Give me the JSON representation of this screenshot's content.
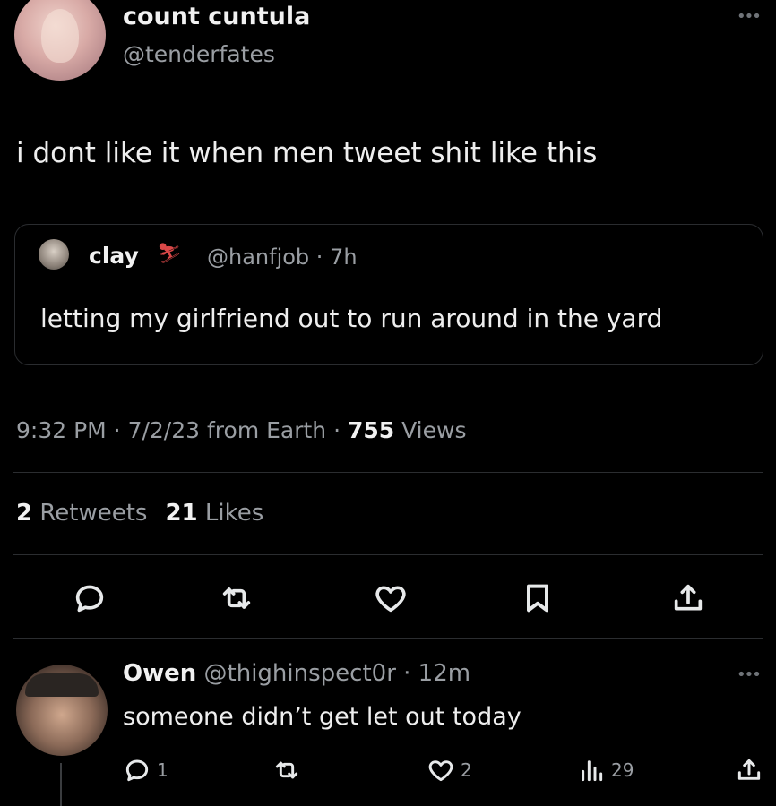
{
  "author": {
    "display_name": "count cuntula",
    "handle": "@tenderfates"
  },
  "tweet": {
    "text": "i dont like it when men tweet shit like this",
    "time": "9:32 PM · 7/2/23 from Earth · ",
    "views_count": "755",
    "views_label": " Views",
    "retweets_count": "2",
    "retweets_label": " Retweets",
    "likes_count": "21",
    "likes_label": " Likes"
  },
  "quote": {
    "name": "clay",
    "emoji": "⛷",
    "handle_time": "@hanfjob · 7h",
    "text": "letting my girlfriend out to run around in the yard"
  },
  "more_glyph": "•••",
  "reply": {
    "name": "Owen",
    "handle_time": " @thighinspect0r · 12m",
    "text": "someone didn’t get let out today",
    "reply_count": "1",
    "like_count": "2",
    "view_count": "29"
  },
  "icons": {
    "reply": "reply-icon",
    "retweet": "retweet-icon",
    "like": "heart-icon",
    "bookmark": "bookmark-icon",
    "share": "share-icon",
    "views": "views-icon",
    "more": "more-icon"
  },
  "colors": {
    "background": "#000000",
    "text": "#e7e9ea",
    "muted": "#9a9ea3",
    "divider": "#2b2d30"
  }
}
